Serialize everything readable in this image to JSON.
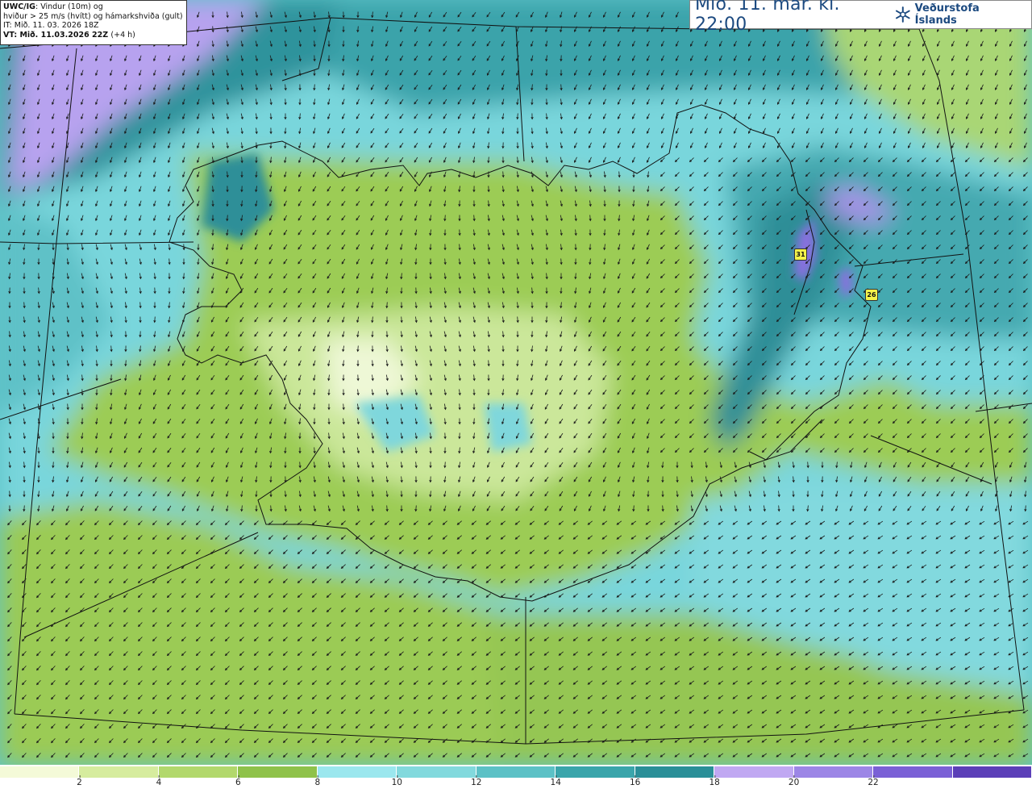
{
  "info": {
    "model": "UWC/IG",
    "line1": "Vindur (10m) og",
    "line2": "hviður > 25 m/s (hvítt) og hámarkshviða (gult)",
    "it": "IT: Mið. 11. 03. 2026 18Z",
    "vt_label": "VT:",
    "vt": "Mið. 11.03.2026 22Z",
    "vt_offset": "(+4 h)"
  },
  "title": {
    "valid_time": "Mið. 11. mar. kl. 22:00",
    "brand": "Veðurstofa Íslands"
  },
  "gusts": [
    {
      "value": "31"
    },
    {
      "value": "26"
    }
  ],
  "legend": {
    "colors": [
      "#f4fad8",
      "#d6ec9e",
      "#b2d86c",
      "#8fc24a",
      "#9be7ee",
      "#82d9dd",
      "#5cc1c6",
      "#3aa5ab",
      "#2a8f98",
      "#c0a8f2",
      "#9c86e6",
      "#7a60d6",
      "#5b3fb8"
    ],
    "ticks": [
      "2",
      "4",
      "6",
      "8",
      "10",
      "12",
      "14",
      "16",
      "18",
      "20",
      "22"
    ]
  }
}
